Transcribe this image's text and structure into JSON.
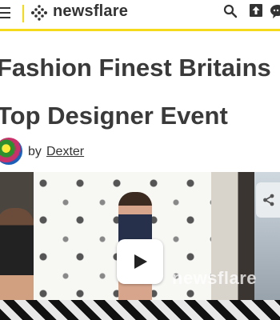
{
  "header": {
    "menu_icon": "hamburger-menu-icon",
    "logo_text": "newsflare",
    "accent_color": "#f5d91b",
    "search_icon": "search-icon",
    "upload_icon": "upload-icon",
    "chat_icon": "chat-icon"
  },
  "article": {
    "title_line1": "Fashion Finest Britains",
    "title_line2": "Top Designer Event",
    "by_label": "by",
    "author": "Dexter"
  },
  "video": {
    "watermark": "newsflare",
    "play_icon": "play-icon",
    "share_icon": "share-icon"
  }
}
